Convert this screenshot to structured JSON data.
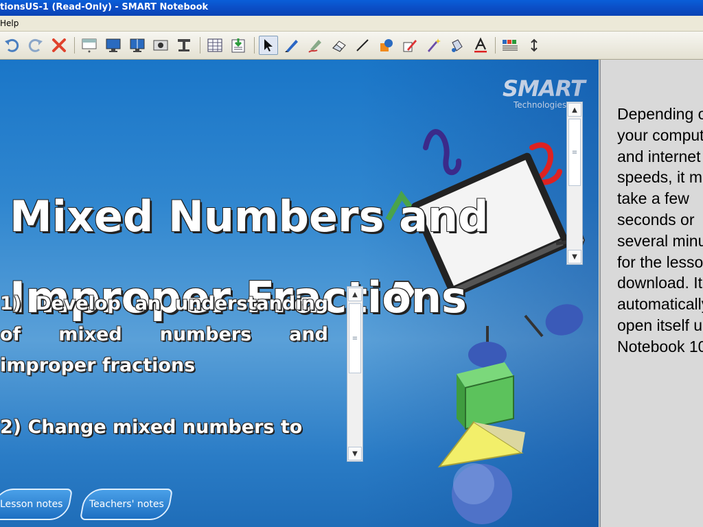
{
  "window": {
    "title": "tionsUS-1 (Read-Only) - SMART Notebook"
  },
  "menu": {
    "items": [
      "Help"
    ]
  },
  "toolbar": {
    "buttons": [
      {
        "name": "undo",
        "icon": "undo-icon"
      },
      {
        "name": "redo",
        "icon": "redo-icon"
      },
      {
        "name": "delete",
        "icon": "delete-x-icon"
      },
      {
        "name": "screen-shade",
        "icon": "screen-shade-icon"
      },
      {
        "name": "full-screen",
        "icon": "monitor-icon"
      },
      {
        "name": "dual-page",
        "icon": "dual-monitor-icon"
      },
      {
        "name": "capture",
        "icon": "camera-icon"
      },
      {
        "name": "document-camera",
        "icon": "doc-camera-icon"
      },
      {
        "name": "insert-table",
        "icon": "table-icon"
      },
      {
        "name": "properties",
        "icon": "clipboard-icon"
      },
      {
        "name": "select",
        "icon": "cursor-arrow-icon"
      },
      {
        "name": "pen",
        "icon": "pen-icon"
      },
      {
        "name": "creative-pen",
        "icon": "creative-pen-icon"
      },
      {
        "name": "eraser",
        "icon": "eraser-icon"
      },
      {
        "name": "line",
        "icon": "line-icon"
      },
      {
        "name": "shapes",
        "icon": "shapes-icon"
      },
      {
        "name": "fill",
        "icon": "fill-pen-icon"
      },
      {
        "name": "magic-pen",
        "icon": "magic-pen-icon"
      },
      {
        "name": "fill-bucket",
        "icon": "fill-bucket-icon"
      },
      {
        "name": "text",
        "icon": "text-A-icon"
      },
      {
        "name": "properties-color",
        "icon": "color-palette-icon"
      },
      {
        "name": "move-toolbar",
        "icon": "up-down-arrow-icon"
      }
    ]
  },
  "slide": {
    "logo_word": "SMART",
    "logo_sub": "Technologies",
    "title_line1": "Mixed Numbers and",
    "title_line2": "Improper Fractions",
    "objectives": [
      "1) Develop an understanding of mixed numbers and improper fractions",
      "2) Change mixed numbers to"
    ],
    "buttons": {
      "lesson_notes": "Lesson notes",
      "teachers_notes": "Teachers' notes"
    }
  },
  "notes_panel": {
    "text": "Depending on your computer and internet speeds, it may take a few seconds or several minutes for the lesson to download. It will automatically open itself up in Notebook 10."
  },
  "colors": {
    "titlebar": "#0a4fc8",
    "slide_bg": "#2f86cf",
    "notes_bg": "#d9d9d9"
  }
}
